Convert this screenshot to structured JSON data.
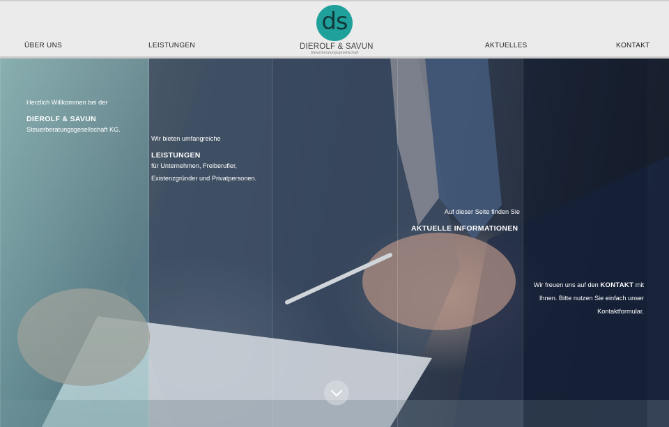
{
  "nav": {
    "left": [
      "ÜBER UNS",
      "LEISTUNGEN"
    ],
    "right": [
      "AKTUELLES",
      "KONTAKT"
    ]
  },
  "logo": {
    "monogram": "ds",
    "name": "DIEROLF & SAVUN",
    "subtitle": "Steuerberatungsgesellschaft",
    "color": "#1fa09a"
  },
  "panels": {
    "welcome": {
      "line1": "Herzlich Willkommen bei der",
      "name": "DIEROLF & SAVUN",
      "line3": "Steuerberatungsgesellschaft KG."
    },
    "services": {
      "line1": "Wir bieten umfangreiche",
      "heading": "LEISTUNGEN",
      "line3": "für Unternehmen, Freiberufler,",
      "line4": "Existenzgründer und Privatpersonen."
    },
    "news": {
      "line1": "Auf dieser Seite finden Sie",
      "heading": "AKTUELLE INFORMATIONEN"
    },
    "contact": {
      "pre": "Wir freuen uns auf den",
      "heading": "KONTAKT",
      "post": "mit",
      "line2": "Ihnen. Bitte nutzen Sie einfach unser",
      "line3": "Kontaktformular."
    }
  },
  "scroll_icon": "chevron-down-icon"
}
